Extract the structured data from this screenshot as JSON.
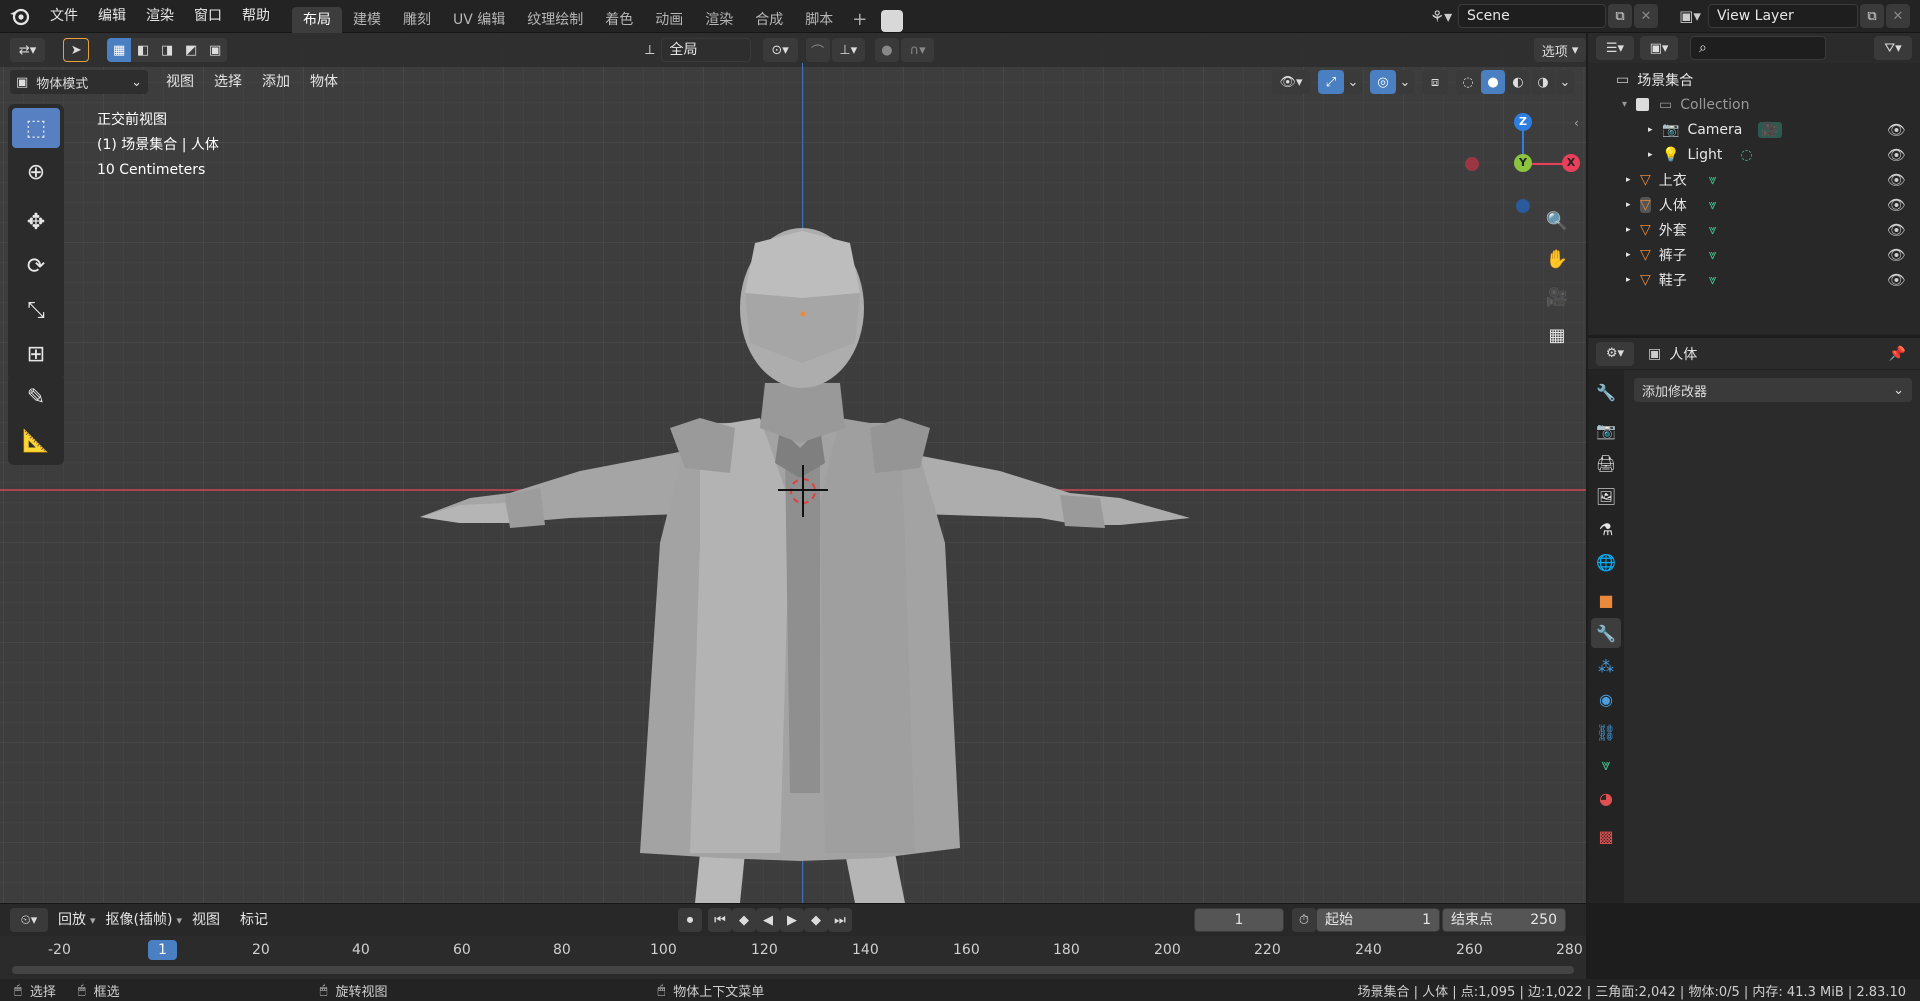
{
  "top_menu": [
    "文件",
    "编辑",
    "渲染",
    "窗口",
    "帮助"
  ],
  "workspaces": [
    "布局",
    "建模",
    "雕刻",
    "UV 编辑",
    "纹理绘制",
    "着色",
    "动画",
    "渲染",
    "合成",
    "脚本"
  ],
  "active_workspace": "布局",
  "scene": {
    "name": "Scene",
    "view_layer": "View Layer"
  },
  "viewport": {
    "transform_orientation": "全局",
    "options_label": "选项",
    "mode": "物体模式",
    "header_menu": [
      "视图",
      "选择",
      "添加",
      "物体"
    ],
    "overlay_lines": [
      "正交前视图",
      "(1) 场景集合 | 人体",
      "10 Centimeters"
    ],
    "gizmo": {
      "z": "Z",
      "y": "Y",
      "x": "X"
    }
  },
  "outliner": {
    "root": "场景集合",
    "collection": "Collection",
    "items": [
      {
        "name": "Camera",
        "type": "camera"
      },
      {
        "name": "Light",
        "type": "light"
      },
      {
        "name": "上衣",
        "type": "mesh"
      },
      {
        "name": "人体",
        "type": "mesh"
      },
      {
        "name": "外套",
        "type": "mesh"
      },
      {
        "name": "裤子",
        "type": "mesh"
      },
      {
        "name": "鞋子",
        "type": "mesh"
      }
    ]
  },
  "properties": {
    "object_name": "人体",
    "add_modifier": "添加修改器"
  },
  "timeline": {
    "menu": [
      "回放",
      "抠像(插帧)",
      "视图",
      "标记"
    ],
    "current_frame": "1",
    "start_label": "起始",
    "start_value": "1",
    "end_label": "结束点",
    "end_value": "250",
    "ruler": [
      "-20",
      "1",
      "20",
      "40",
      "60",
      "80",
      "100",
      "120",
      "140",
      "160",
      "180",
      "200",
      "220",
      "240",
      "260",
      "280"
    ]
  },
  "statusbar": {
    "select": "选择",
    "box_select": "框选",
    "rotate_view": "旋转视图",
    "context_menu": "物体上下文菜单",
    "stats": "场景集合 | 人体 | 点:1,095 | 边:1,022 | 三角面:2,042 | 物体:0/5 | 内存: 41.3 MiB | 2.83.10"
  },
  "colors": {
    "accent": "#4a7fc1",
    "mesh_icon": "#e8893c",
    "data_icon": "#3fc08b",
    "x_axis": "#e8405a",
    "y_axis": "#8bc53f",
    "z_axis": "#2e7de0"
  }
}
